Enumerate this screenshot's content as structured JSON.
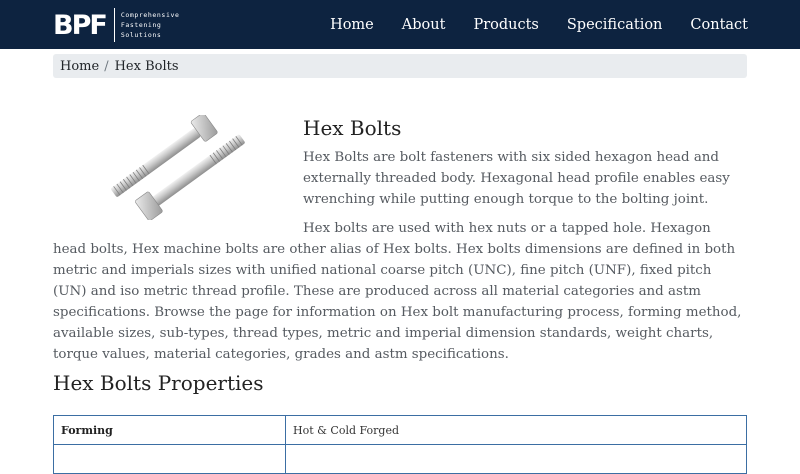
{
  "header": {
    "logo_text": "BPF",
    "logo_tagline": [
      "Comprehensive",
      "Fastening",
      "Solutions"
    ],
    "nav": [
      {
        "label": "Home"
      },
      {
        "label": "About"
      },
      {
        "label": "Products"
      },
      {
        "label": "Specification"
      },
      {
        "label": "Contact"
      }
    ],
    "background_color": "#0d2340"
  },
  "breadcrumb": {
    "items": [
      "Home",
      "Hex Bolts"
    ],
    "separator": "/"
  },
  "main": {
    "title": "Hex Bolts",
    "intro": "Hex Bolts are bolt fasteners with six sided hexagon head and externally threaded body. Hexagonal head profile enables easy wrenching while putting enough torque to the bolting joint.",
    "detail": "Hex bolts are used with hex nuts or a tapped hole. Hexagon head bolts, Hex machine bolts are other alias of Hex bolts. Hex bolts dimensions are defined in both metric and imperials sizes with unified national coarse pitch (UNC), fine pitch (UNF), fixed pitch (UN) and iso metric thread profile. These are produced across all material categories and astm specifications. Browse the page for information on Hex bolt manufacturing process, forming method, available sizes, sub-types, thread types, metric and imperial dimension standards, weight charts, torque values, material categories, grades and astm specifications.",
    "image_icon": "hex-bolts-image"
  },
  "properties": {
    "title": "Hex Bolts Properties",
    "rows": [
      {
        "key": "Forming",
        "value": "Hot & Cold Forged"
      },
      {
        "key": "",
        "value": ""
      }
    ],
    "border_color": "#3b6ea3"
  }
}
